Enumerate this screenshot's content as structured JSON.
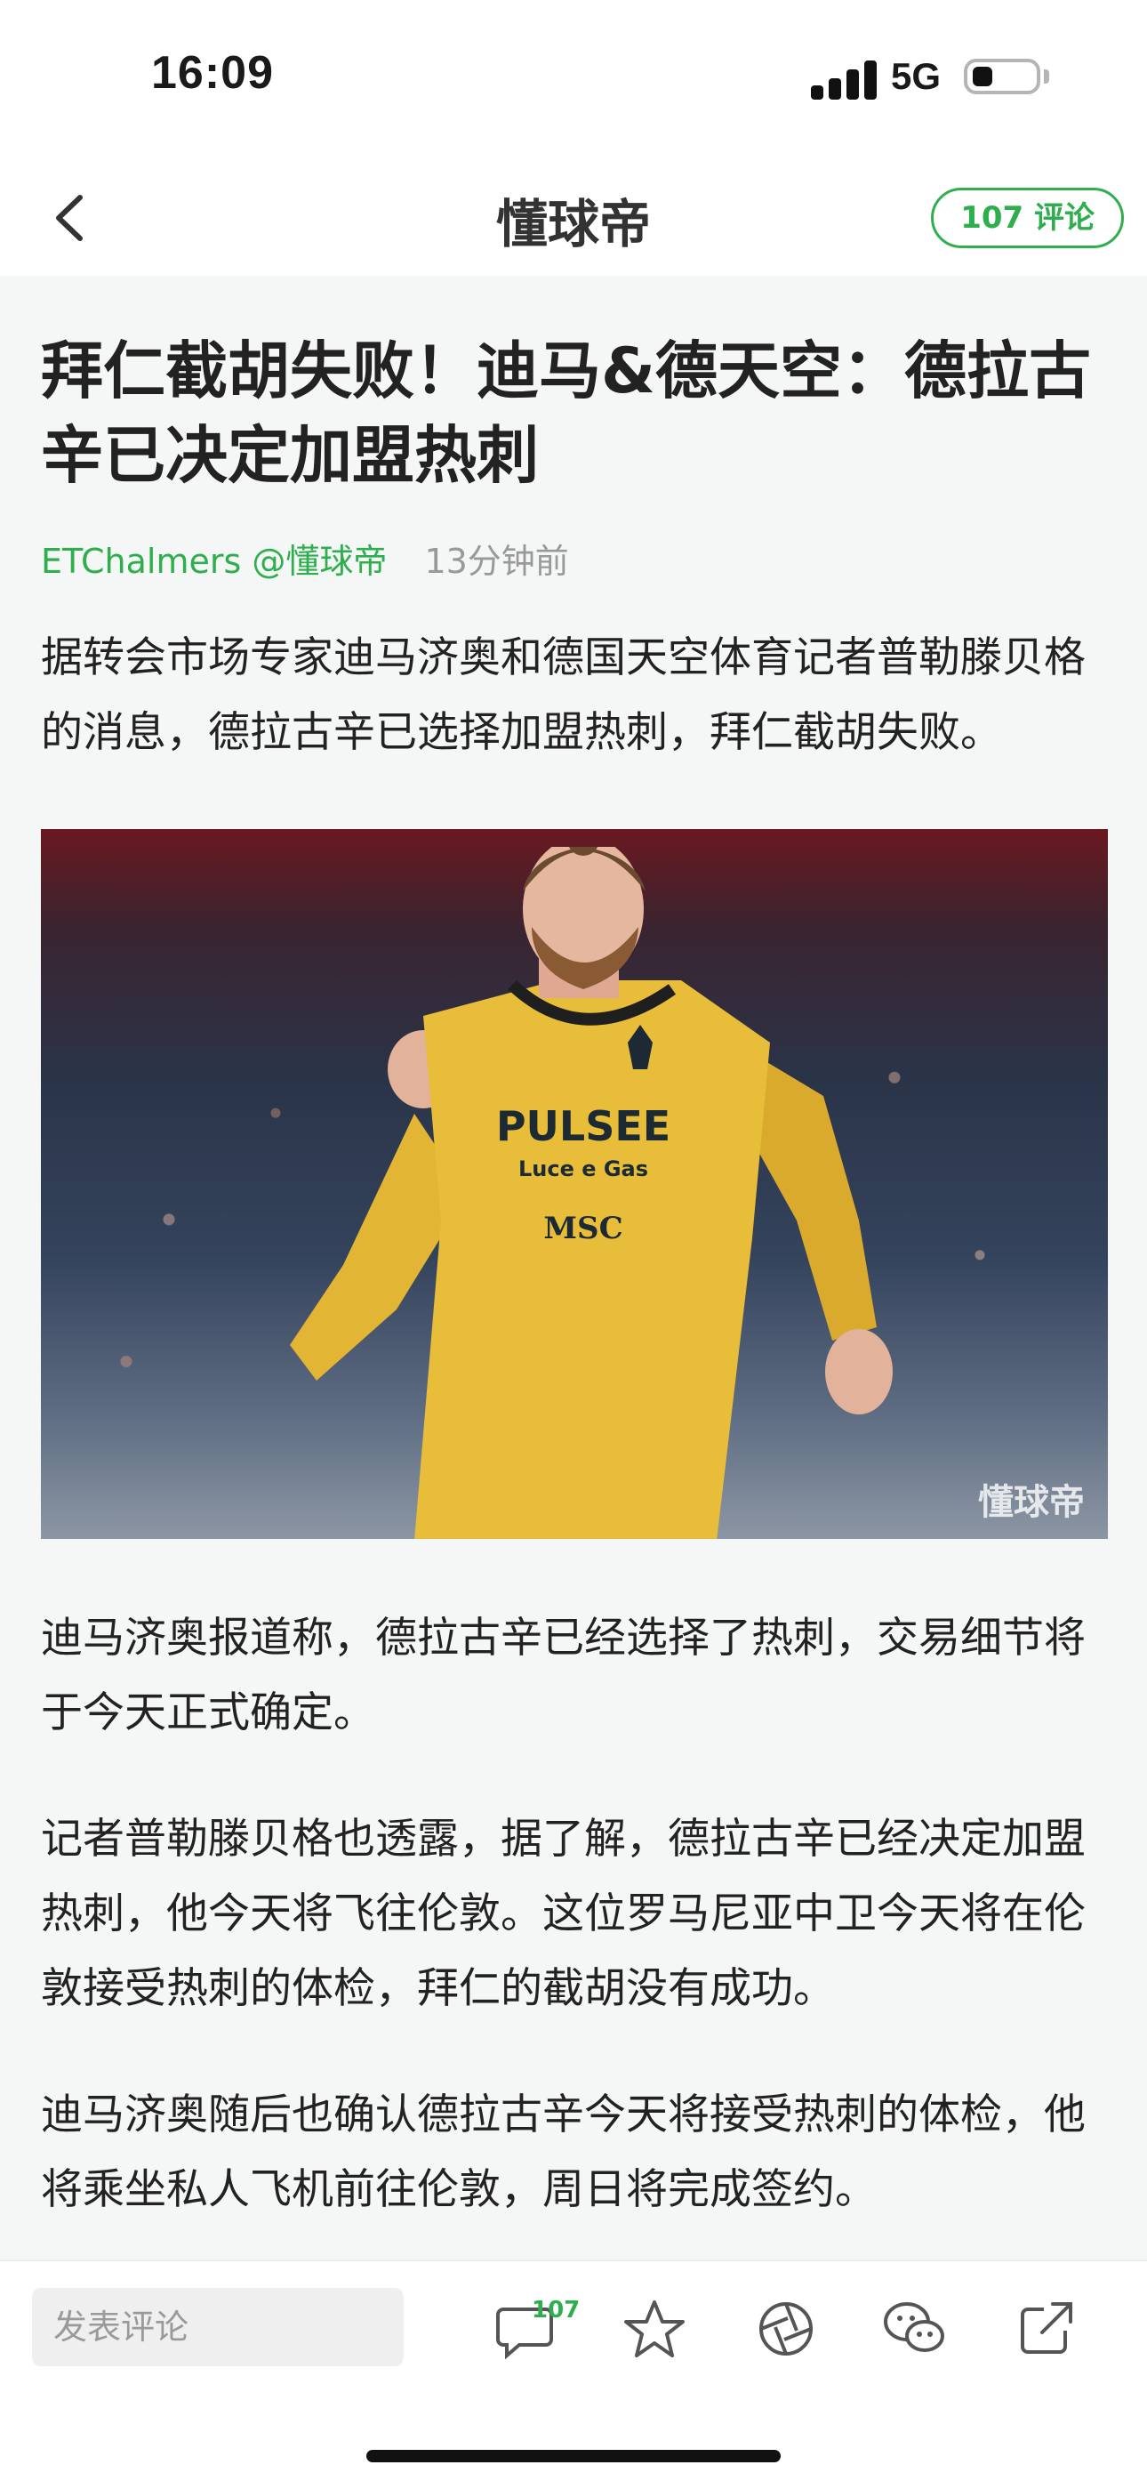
{
  "status_bar": {
    "time": "16:09",
    "network": "5G",
    "battery_level": 0.2,
    "icons": [
      "signal-icon",
      "battery-icon"
    ]
  },
  "nav": {
    "brand": "懂球帝",
    "comments_button": "107 评论",
    "icons": [
      "back-arrow-icon"
    ]
  },
  "article": {
    "headline": "拜仁截胡失败！迪马&德天空：德拉古辛已决定加盟热刺",
    "author": "ETChalmers @懂球帝",
    "time": "13分钟前",
    "paragraphs": [
      "据转会市场专家迪马济奥和德国天空体育记者普勒滕贝格的消息，德拉古辛已选择加盟热刺，拜仁截胡失败。",
      "迪马济奥报道称，德拉古辛已经选择了热刺，交易细节将于今天正式确定。",
      "记者普勒滕贝格也透露，据了解，德拉古辛已经决定加盟热刺，他今天将飞往伦敦。这位罗马尼亚中卫今天将在伦敦接受热刺的体检，拜仁的截胡没有成功。",
      "迪马济奥随后也确认德拉古辛今天将接受热刺的体检，他将乘坐私人飞机前往伦敦，周日将完成签约。"
    ],
    "image": {
      "jersey_sponsor": "PULSEE",
      "jersey_sponsor_sub": "Luce e Gas",
      "jersey_sponsor2": "MSC",
      "watermark": "懂球帝"
    }
  },
  "bottom_bar": {
    "comment_placeholder": "发表评论",
    "comment_count": "107",
    "icons": [
      "comment-icon",
      "star-icon",
      "moments-icon",
      "wechat-icon",
      "share-icon"
    ]
  },
  "colors": {
    "accent": "#2fae4d",
    "text": "#222222",
    "muted": "#999999",
    "background": "#f5f6f6"
  }
}
